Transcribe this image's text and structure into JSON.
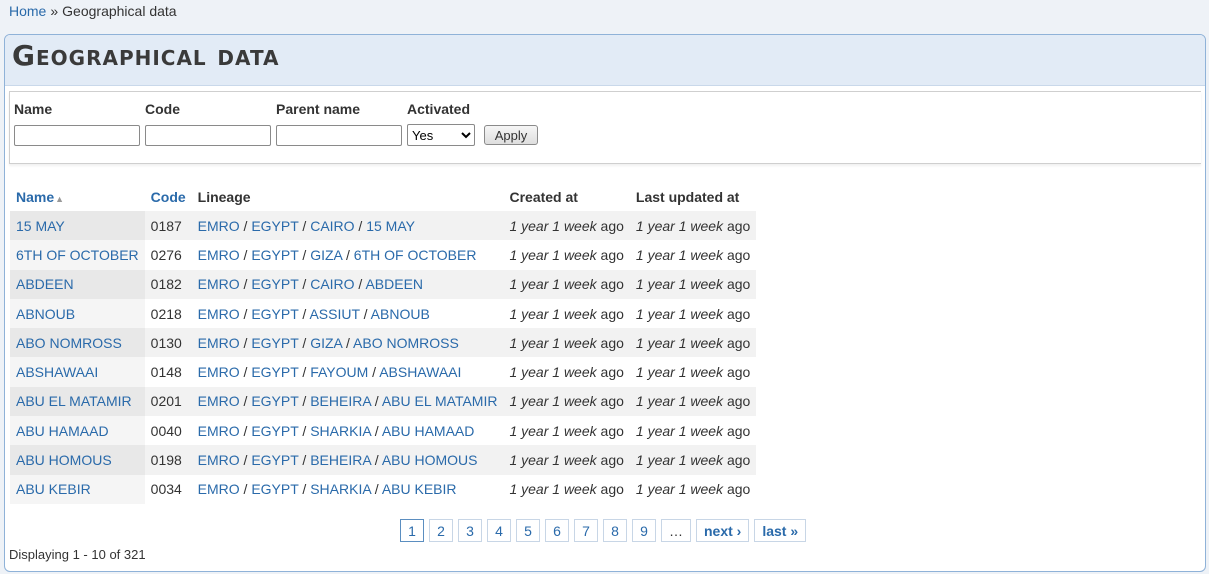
{
  "breadcrumb": {
    "home": "Home",
    "separator": "»",
    "current": "Geographical data"
  },
  "page": {
    "title": "Geographical data"
  },
  "filters": {
    "name_label": "Name",
    "code_label": "Code",
    "parent_label": "Parent name",
    "activated_label": "Activated",
    "activated_value": "Yes",
    "name_value": "",
    "code_value": "",
    "parent_value": "",
    "apply_label": "Apply"
  },
  "table": {
    "headers": {
      "name": "Name",
      "code": "Code",
      "lineage": "Lineage",
      "created": "Created at",
      "updated": "Last updated at"
    },
    "rows": [
      {
        "name": "15 MAY",
        "code": "0187",
        "lineage": [
          "EMRO",
          "EGYPT",
          "CAIRO",
          "15 MAY"
        ],
        "created_em": "1 year 1 week",
        "created_tail": " ago",
        "updated_em": "1 year 1 week",
        "updated_tail": " ago"
      },
      {
        "name": "6TH OF OCTOBER",
        "code": "0276",
        "lineage": [
          "EMRO",
          "EGYPT",
          "GIZA",
          "6TH OF OCTOBER"
        ],
        "created_em": "1 year 1 week",
        "created_tail": " ago",
        "updated_em": "1 year 1 week",
        "updated_tail": " ago"
      },
      {
        "name": "ABDEEN",
        "code": "0182",
        "lineage": [
          "EMRO",
          "EGYPT",
          "CAIRO",
          "ABDEEN"
        ],
        "created_em": "1 year 1 week",
        "created_tail": " ago",
        "updated_em": "1 year 1 week",
        "updated_tail": " ago"
      },
      {
        "name": "ABNOUB",
        "code": "0218",
        "lineage": [
          "EMRO",
          "EGYPT",
          "ASSIUT",
          "ABNOUB"
        ],
        "created_em": "1 year 1 week",
        "created_tail": " ago",
        "updated_em": "1 year 1 week",
        "updated_tail": " ago"
      },
      {
        "name": "ABO NOMROSS",
        "code": "0130",
        "lineage": [
          "EMRO",
          "EGYPT",
          "GIZA",
          "ABO NOMROSS"
        ],
        "created_em": "1 year 1 week",
        "created_tail": " ago",
        "updated_em": "1 year 1 week",
        "updated_tail": " ago"
      },
      {
        "name": "ABSHAWAAI",
        "code": "0148",
        "lineage": [
          "EMRO",
          "EGYPT",
          "FAYOUM",
          "ABSHAWAAI"
        ],
        "created_em": "1 year 1 week",
        "created_tail": " ago",
        "updated_em": "1 year 1 week",
        "updated_tail": " ago"
      },
      {
        "name": "ABU EL MATAMIR",
        "code": "0201",
        "lineage": [
          "EMRO",
          "EGYPT",
          "BEHEIRA",
          "ABU EL MATAMIR"
        ],
        "created_em": "1 year 1 week",
        "created_tail": " ago",
        "updated_em": "1 year 1 week",
        "updated_tail": " ago"
      },
      {
        "name": "ABU HAMAAD",
        "code": "0040",
        "lineage": [
          "EMRO",
          "EGYPT",
          "SHARKIA",
          "ABU HAMAAD"
        ],
        "created_em": "1 year 1 week",
        "created_tail": " ago",
        "updated_em": "1 year 1 week",
        "updated_tail": " ago"
      },
      {
        "name": "ABU HOMOUS",
        "code": "0198",
        "lineage": [
          "EMRO",
          "EGYPT",
          "BEHEIRA",
          "ABU HOMOUS"
        ],
        "created_em": "1 year 1 week",
        "created_tail": " ago",
        "updated_em": "1 year 1 week",
        "updated_tail": " ago"
      },
      {
        "name": "ABU KEBIR",
        "code": "0034",
        "lineage": [
          "EMRO",
          "EGYPT",
          "SHARKIA",
          "ABU KEBIR"
        ],
        "created_em": "1 year 1 week",
        "created_tail": " ago",
        "updated_em": "1 year 1 week",
        "updated_tail": " ago"
      }
    ]
  },
  "pagination": {
    "pages": [
      "1",
      "2",
      "3",
      "4",
      "5",
      "6",
      "7",
      "8",
      "9"
    ],
    "current": "1",
    "ellipsis": "…",
    "next_label": "next ›",
    "last_label": "last »"
  },
  "summary": "Displaying 1 - 10 of 321",
  "colors": {
    "link": "#2a6aaa",
    "header_bg": "#e2ebf6",
    "panel_border": "#8fb2d8"
  }
}
